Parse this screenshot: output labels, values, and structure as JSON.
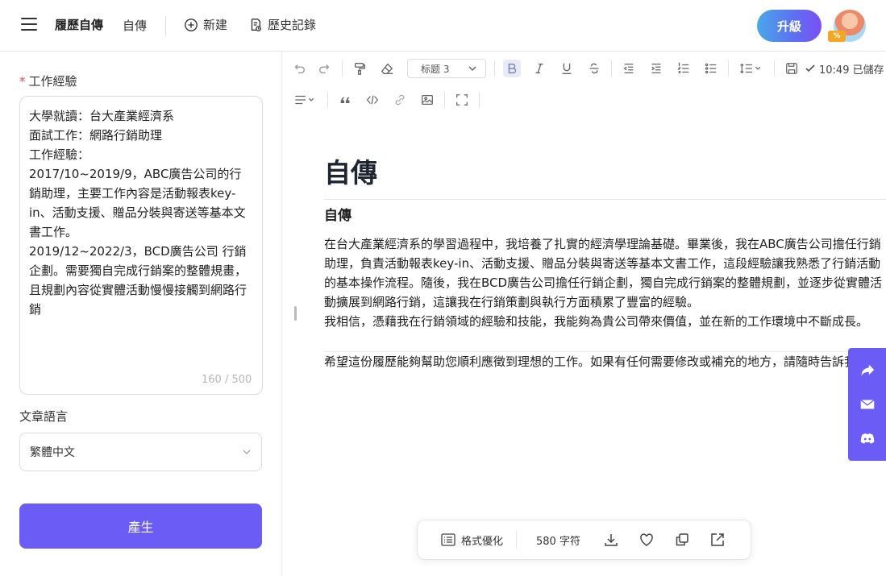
{
  "header": {
    "brand": "履歷自傳",
    "subtitle": "自傳",
    "new_label": "新建",
    "history_label": "歷史記錄",
    "upgrade_label": "升級",
    "avatar_badge": "%"
  },
  "left": {
    "field_label": "工作經驗",
    "required_mark": "*",
    "textarea_value": "大學就讀：台大產業經濟系\n面試工作：網路行銷助理\n工作經驗：\n2017/10~2019/9，ABC廣告公司的行銷助理，主要工作內容是活動報表key-in、活動支援、贈品分裝與寄送等基本文書工作。\n2019/12~2022/3，BCD廣告公司 行銷企劃。需要獨自完成行銷案的整體規畫，且規劃內容從實體活動慢慢接觸到網路行銷",
    "char_count": "160 / 500",
    "language_label": "文章語言",
    "language_value": "繁體中文",
    "generate_label": "產生"
  },
  "toolbar": {
    "heading_value": "标题 3",
    "saved_text": "10:49 已儲存"
  },
  "document": {
    "title": "自傳",
    "heading": "自傳",
    "p1": "在台大產業經濟系的學習過程中，我培養了扎實的經濟學理論基礎。畢業後，我在ABC廣告公司擔任行銷助理，負責活動報表key-in、活動支援、贈品分裝與寄送等基本文書工作，這段經驗讓我熟悉了行銷活動的基本操作流程。隨後，我在BCD廣告公司擔任行銷企劃，獨自完成行銷案的整體規劃，並逐步從實體活動擴展到網路行銷，這讓我在行銷策劃與執行方面積累了豐富的經驗。",
    "p2": "我相信，憑藉我在行銷領域的經驗和技能，我能夠為貴公司帶來價值，並在新的工作環境中不斷成長。",
    "p3": "希望這份履歷能夠幫助您順利應徵到理想的工作。如果有任何需要修改或補充的地方，請隨時告訴我。"
  },
  "floatbar": {
    "format_label": "格式優化",
    "word_count": "580 字符"
  }
}
